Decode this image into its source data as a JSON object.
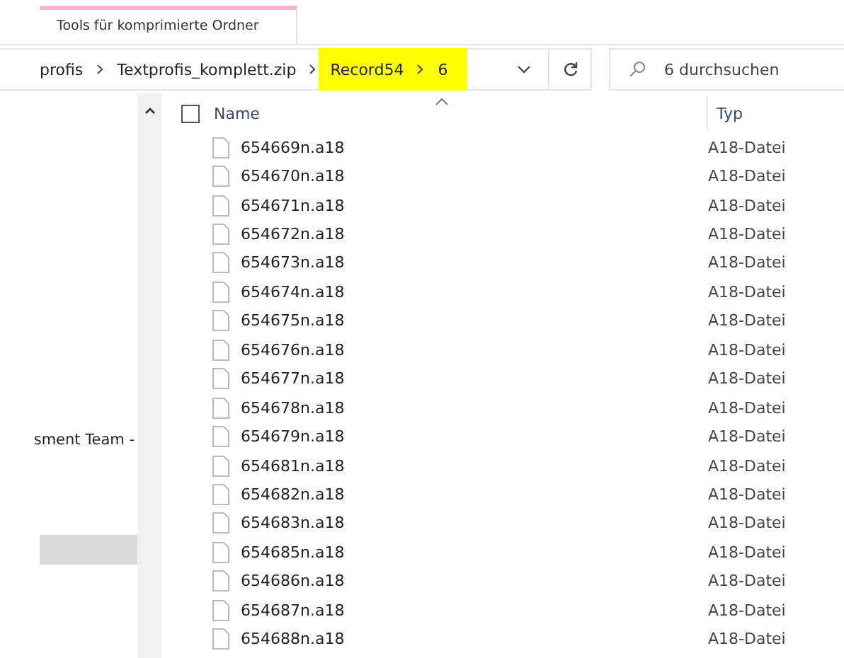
{
  "ribbon": {
    "tab": "Tools für komprimierte Ordner"
  },
  "breadcrumb": {
    "items": [
      {
        "label": "profis",
        "highlighted": false
      },
      {
        "label": "Textprofis_komplett.zip",
        "highlighted": false
      },
      {
        "label": "Record54",
        "highlighted": true
      },
      {
        "label": "6",
        "highlighted": true
      }
    ]
  },
  "search": {
    "placeholder": "6 durchsuchen"
  },
  "nav": {
    "items": [
      {
        "label": "sment Team -",
        "selected": false
      },
      {
        "selected": true
      }
    ]
  },
  "columns": [
    "Name",
    "Typ"
  ],
  "select_all": {
    "checked": false
  },
  "files": [
    {
      "name": "654669n.a18",
      "type": "A18-Datei"
    },
    {
      "name": "654670n.a18",
      "type": "A18-Datei"
    },
    {
      "name": "654671n.a18",
      "type": "A18-Datei"
    },
    {
      "name": "654672n.a18",
      "type": "A18-Datei"
    },
    {
      "name": "654673n.a18",
      "type": "A18-Datei"
    },
    {
      "name": "654674n.a18",
      "type": "A18-Datei"
    },
    {
      "name": "654675n.a18",
      "type": "A18-Datei"
    },
    {
      "name": "654676n.a18",
      "type": "A18-Datei"
    },
    {
      "name": "654677n.a18",
      "type": "A18-Datei"
    },
    {
      "name": "654678n.a18",
      "type": "A18-Datei"
    },
    {
      "name": "654679n.a18",
      "type": "A18-Datei"
    },
    {
      "name": "654681n.a18",
      "type": "A18-Datei"
    },
    {
      "name": "654682n.a18",
      "type": "A18-Datei"
    },
    {
      "name": "654683n.a18",
      "type": "A18-Datei"
    },
    {
      "name": "654685n.a18",
      "type": "A18-Datei"
    },
    {
      "name": "654686n.a18",
      "type": "A18-Datei"
    },
    {
      "name": "654687n.a18",
      "type": "A18-Datei"
    },
    {
      "name": "654688n.a18",
      "type": "A18-Datei"
    }
  ]
}
